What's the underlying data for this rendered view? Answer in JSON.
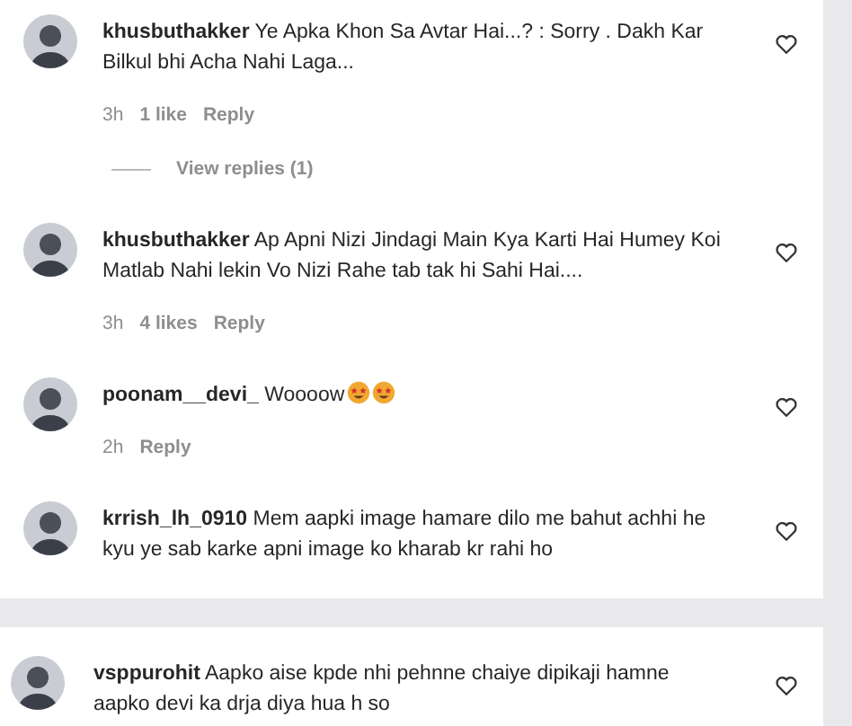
{
  "panels": [
    {
      "comments": [
        {
          "username": "khusbuthakker",
          "text": "Ye Apka Khon Sa Avtar Hai...? : Sorry . Dakh Kar Bilkul bhi Acha Nahi Laga...",
          "liked": false,
          "meta": [
            "3h",
            "1 like",
            "Reply"
          ],
          "view_replies": "View replies (1)"
        },
        {
          "username": "khusbuthakker",
          "text": "Ap Apni Nizi Jindagi Main Kya Karti Hai Humey Koi Matlab Nahi lekin Vo Nizi Rahe tab tak hi Sahi Hai....",
          "liked": false,
          "meta": [
            "3h",
            "4 likes",
            "Reply"
          ]
        },
        {
          "username": "poonam__devi_",
          "text": "Woooow",
          "emojis": [
            {
              "kind": "star-eyes"
            },
            {
              "kind": "star-eyes"
            }
          ],
          "liked": false,
          "meta": [
            "2h",
            "Reply"
          ]
        },
        {
          "username": "krrish_lh_0910",
          "text": "Mem aapki image hamare dilo me bahut achhi he kyu ye sab karke apni image ko kharab kr rahi ho",
          "liked": false
        }
      ]
    },
    {
      "comments": [
        {
          "username": "vsppurohit",
          "text": "Aapko aise kpde nhi pehnne chaiye dipikaji hamne aapko devi ka drja diya hua h so",
          "liked": false
        }
      ]
    }
  ]
}
